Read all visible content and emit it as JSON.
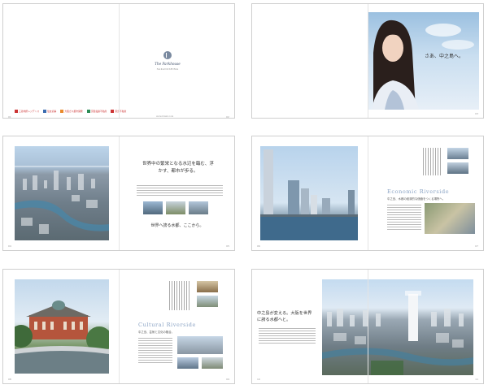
{
  "spread1": {
    "brand_name": "The Parkhouse",
    "brand_sub": "NAKANOSHIMA",
    "url": "www.brand.com",
    "companies": [
      "三菱地所レジデンス",
      "住友商事",
      "大阪ガス都市開発",
      "京阪電鉄不動産",
      "東急不動産"
    ],
    "page_left": "01",
    "page_right": "02"
  },
  "spread2": {
    "catchcopy": "さあ、中之島へ。",
    "page_right": "03"
  },
  "spread3": {
    "headline": "世界中の繁栄となる水辺を臨む、浮かす、都市が歩る。",
    "tagline": "世界へ誇る水都、ここから。",
    "page_left": "04",
    "page_right": "05"
  },
  "spread4": {
    "english_title": "Economic Riverside",
    "subtitle": "中之島、水都の経済的な価値をつくる場所へ。",
    "page_left": "06",
    "page_right": "07"
  },
  "spread5": {
    "english_title": "Cultural Riverside",
    "subtitle": "中之島、芸術と文化の融合。",
    "page_left": "08",
    "page_right": "09"
  },
  "spread6": {
    "headline": "中之島が変える。大阪を世界に誇る水都へと。",
    "page_left": "10",
    "page_right": "11"
  }
}
